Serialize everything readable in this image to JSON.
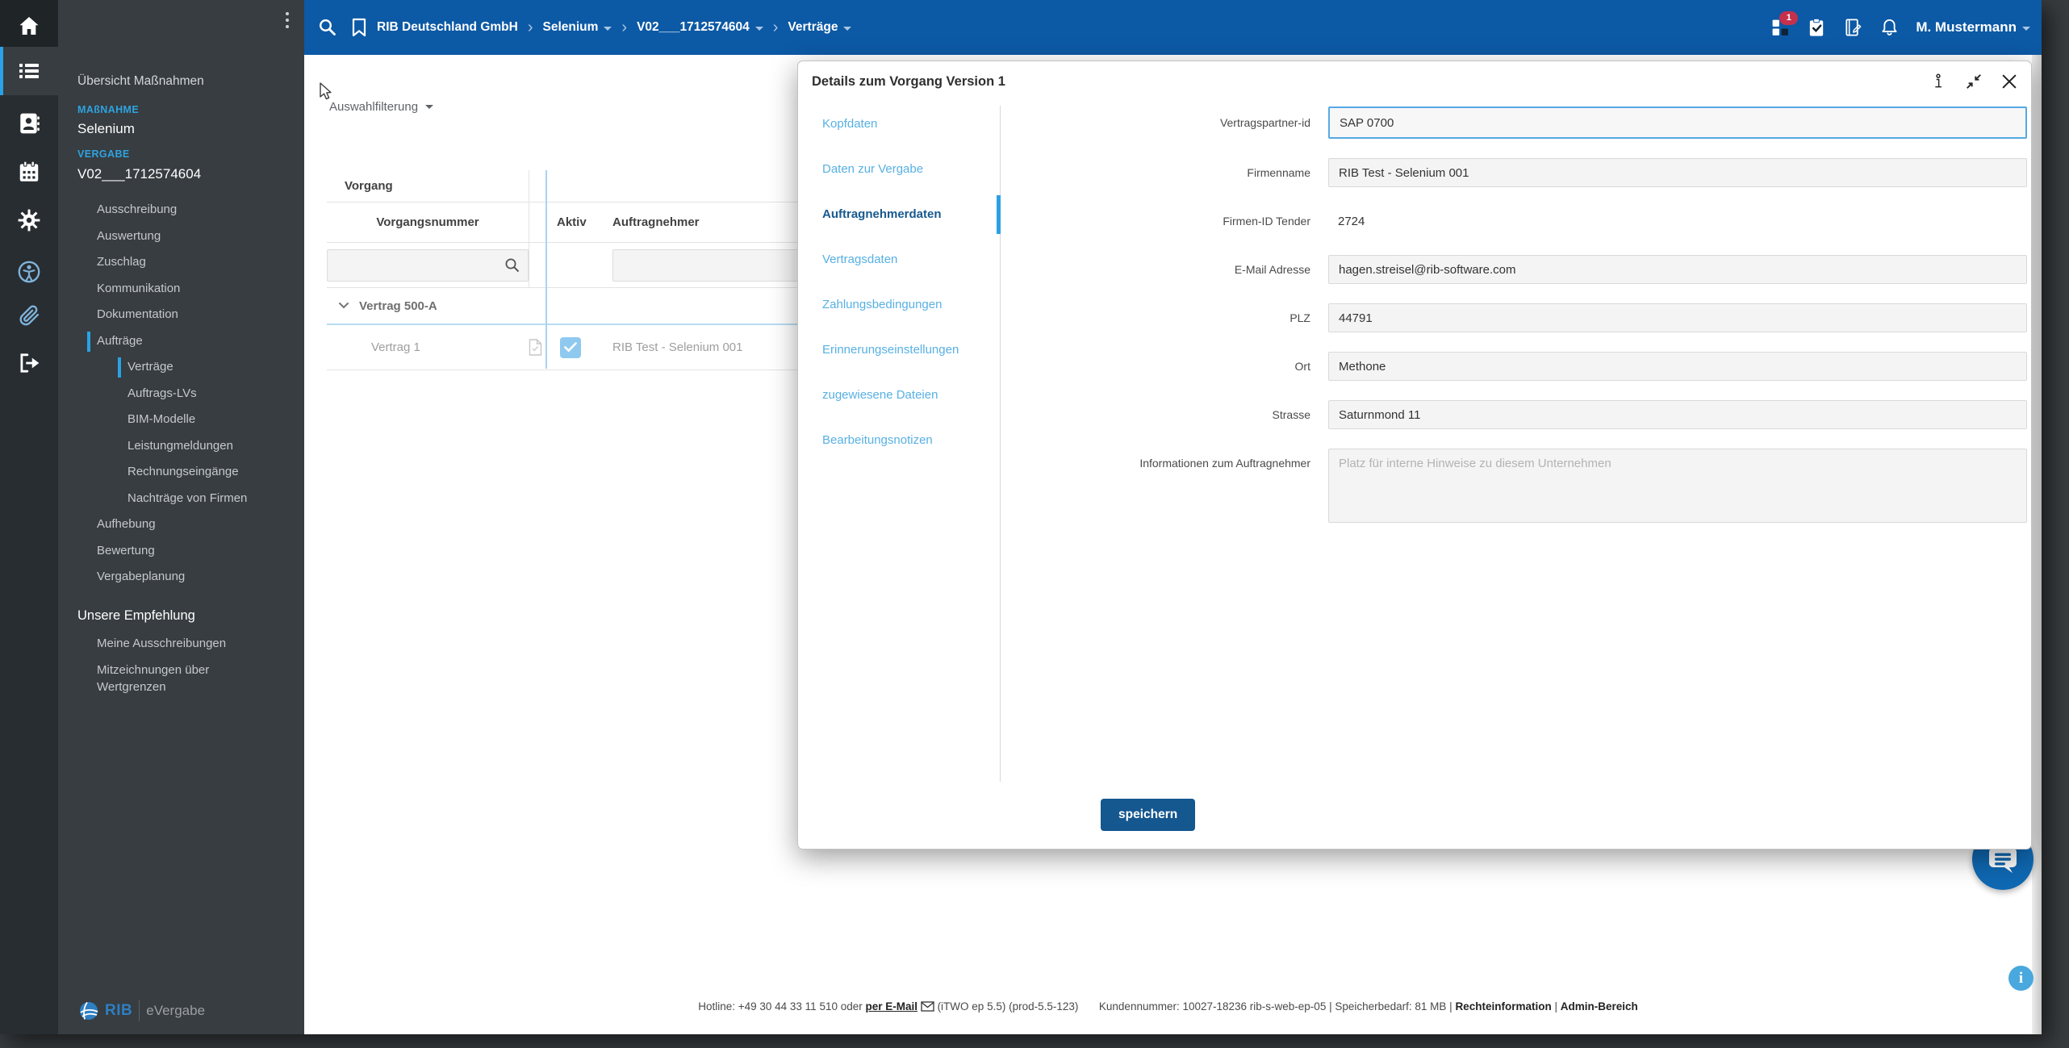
{
  "colors": {
    "topbar": "#0c59a5",
    "accent": "#2aa2e5",
    "save": "#15578f",
    "badge": "#c5304c"
  },
  "topbar": {
    "breadcrumb": [
      {
        "label": "RIB Deutschland GmbH"
      },
      {
        "label": "Selenium"
      },
      {
        "label": "V02___1712574604"
      },
      {
        "label": "Verträge"
      }
    ],
    "icons": [
      "search",
      "bookmark",
      "modules",
      "tasks-clipboard",
      "notes-book",
      "notifications-bell"
    ],
    "badge_count": "1",
    "user_name": "M. Mustermann"
  },
  "sidebar": {
    "overview": "Übersicht Maßnahmen",
    "group1_label": "MAßNAHME",
    "group1_value": "Selenium",
    "group2_label": "VERGABE",
    "group2_value": "V02___1712574604",
    "items": [
      {
        "label": "Ausschreibung"
      },
      {
        "label": "Auswertung"
      },
      {
        "label": "Zuschlag"
      },
      {
        "label": "Kommunikation"
      },
      {
        "label": "Dokumentation"
      },
      {
        "label": "Aufträge",
        "active": true
      },
      {
        "label": "Verträge",
        "active": true
      },
      {
        "label": "Auftrags-LVs"
      },
      {
        "label": "BIM-Modelle"
      },
      {
        "label": "Leistungmeldungen"
      },
      {
        "label": "Rechnungseingänge"
      },
      {
        "label": "Nachträge von Firmen"
      },
      {
        "label": "Aufhebung"
      },
      {
        "label": "Bewertung"
      },
      {
        "label": "Vergabeplanung"
      }
    ],
    "section2": "Unsere Empfehlung",
    "items2": [
      {
        "label": "Meine Ausschreibungen"
      },
      {
        "label": "Mitzeichnungen über Wertgrenzen"
      }
    ],
    "rail_icons": [
      "home",
      "list-measures",
      "contacts",
      "calendar",
      "settings-gear",
      "accessibility",
      "paperclip",
      "logout"
    ]
  },
  "content": {
    "filter_label": "Auswahlfilterung",
    "table": {
      "group_header": "Vorgang",
      "columns": [
        "Vorgangsnummer",
        "Aktiv",
        "Auftragnehmer"
      ],
      "group_row": "Vertrag 500-A",
      "row": {
        "vorgangsnummer": "Vertrag 1",
        "aktiv_checked": true,
        "auftragnehmer": "RIB Test - Selenium 001"
      }
    }
  },
  "modal": {
    "title": "Details zum Vorgang Version 1",
    "header_icons": [
      "info-pawn",
      "collapse",
      "close"
    ],
    "tabs": [
      {
        "label": "Kopfdaten"
      },
      {
        "label": "Daten zur Vergabe"
      },
      {
        "label": "Auftragnehmerdaten",
        "active": true
      },
      {
        "label": "Vertragsdaten"
      },
      {
        "label": "Zahlungsbedingungen"
      },
      {
        "label": "Erinnerungseinstellungen"
      },
      {
        "label": "zugewiesene Dateien"
      },
      {
        "label": "Bearbeitungsnotizen"
      }
    ],
    "fields": [
      {
        "label": "Vertragspartner-id",
        "value": "SAP 0700"
      },
      {
        "label": "Firmenname",
        "value": "RIB Test - Selenium 001"
      },
      {
        "label": "Firmen-ID Tender",
        "value": "2724"
      },
      {
        "label": "E-Mail Adresse",
        "value": "hagen.streisel@rib-software.com"
      },
      {
        "label": "PLZ",
        "value": "44791"
      },
      {
        "label": "Ort",
        "value": "Methone"
      },
      {
        "label": "Strasse",
        "value": "Saturnmond 11"
      }
    ],
    "notes": {
      "label": "Informationen zum Auftragnehmer",
      "placeholder": "Platz für interne Hinweise zu diesem Unternehmen"
    },
    "save_label": "speichern"
  },
  "footer": {
    "hotline": "Hotline: +49 30 44 33 11 510 oder",
    "email_link": "per E-Mail",
    "version": "(iTWO ep 5.5) (prod-5.5-123)",
    "customer": "Kundennummer: 10027-18236 rib-s-web-ep-05 | Speicherbedarf: 81 MB |",
    "rights_link": "Rechteinformation",
    "sep": "|",
    "admin_link": "Admin-Bereich"
  },
  "brand": {
    "name": "RIB",
    "product": "eVergabe"
  }
}
